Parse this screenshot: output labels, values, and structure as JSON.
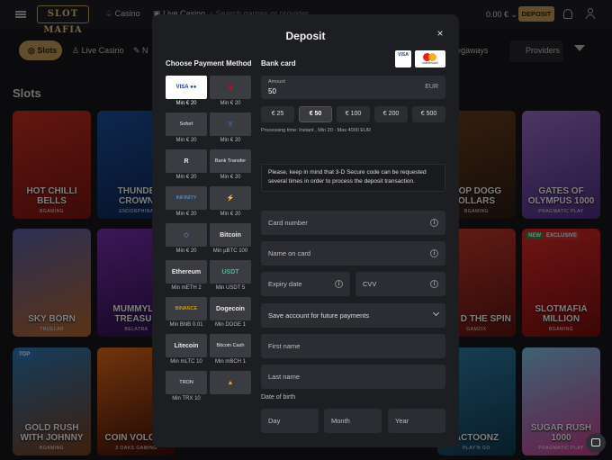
{
  "header": {
    "logo_text": "SLOT MAFIA",
    "casino_label": "Casino",
    "live_casino_label": "Live Casino",
    "search_placeholder": "Search games or provider",
    "balance": "0.00 €",
    "deposit_label": "DEPOSIT"
  },
  "categories": {
    "slots": "Slots",
    "live": "Live Casino",
    "new": "N",
    "megaways": "egaways",
    "providers": "Providers"
  },
  "section_title": "Slots",
  "games": [
    {
      "title": "HOT CHILLI BELLS",
      "provider": "BGAMING"
    },
    {
      "title": "THUNDE CROWN",
      "provider": "ENDORPHINA"
    },
    {
      "title": "OOP DOGG OLLARS",
      "provider": "BGAMING"
    },
    {
      "title": "GATES OF OLYMPUS 1000",
      "provider": "PRAGMATIC PLAY"
    },
    {
      "title": "SKY BORN",
      "provider": "TRUELAB"
    },
    {
      "title": "MUMMYLA TREASUR",
      "provider": "BELATRA"
    },
    {
      "title": "3X3 D THE SPIN",
      "provider": "GAMZIX"
    },
    {
      "title": "SLOTMAFIA MILLION",
      "provider": "BGAMING",
      "badges": [
        "NEW",
        "EXCLUSIVE"
      ]
    },
    {
      "title": "GOLD RUSH WITH JOHNNY",
      "provider": "BGAMING",
      "badges": [
        "TOP"
      ]
    },
    {
      "title": "COIN VOLCAN",
      "provider": "3 OAKS GAMING"
    },
    {
      "title": "ACTOONZ",
      "provider": "PLAY'N GO"
    },
    {
      "title": "SUGAR RUSH 1000",
      "provider": "PRAGMATIC PLAY"
    }
  ],
  "modal": {
    "title": "Deposit",
    "close": "×",
    "choose_method_label": "Choose Payment Method",
    "bank_card_label": "Bank card",
    "card_logos": [
      "VISA",
      "mastercard"
    ],
    "methods": [
      {
        "label": "VISA ●●",
        "caption": "Min € 20"
      },
      {
        "label": "S",
        "caption": "Min € 20"
      },
      {
        "label": "Sofort",
        "caption": "Min € 20"
      },
      {
        "label": "V",
        "caption": "Min € 20"
      },
      {
        "label": "R",
        "caption": "Min € 20"
      },
      {
        "label": "Bank Transfer",
        "caption": "Min € 20"
      },
      {
        "label": "INFINITY",
        "caption": "Min € 20"
      },
      {
        "label": "⚡",
        "caption": "Min € 20"
      },
      {
        "label": "◇",
        "caption": "Min € 20"
      },
      {
        "label": "Bitcoin",
        "caption": "Min µBTC 100"
      },
      {
        "label": "Ethereum",
        "caption": "Min mETH 2"
      },
      {
        "label": "USDT",
        "caption": "Min USDT 5"
      },
      {
        "label": "BINANCE",
        "caption": "Min BNB 0.01"
      },
      {
        "label": "Dogecoin",
        "caption": "Min DOGE 1"
      },
      {
        "label": "Litecoin",
        "caption": "Min mLTC 10"
      },
      {
        "label": "Bitcoin Cash",
        "caption": "Min mBCH 1"
      },
      {
        "label": "TRON",
        "caption": "Min TRX 10"
      },
      {
        "label": "▲",
        "caption": ""
      }
    ],
    "amount_caption": "Amount",
    "amount_value": "50",
    "currency": "EUR",
    "quick_amounts": [
      "€ 25",
      "€ 50",
      "€ 100",
      "€ 200",
      "€ 500"
    ],
    "selected_amount": "€ 50",
    "processing_text": "Processing time: Instant , Min 20 - Max 4000 EUR",
    "secure_note": "Please, keep in mind that 3-D Secure code can be requested several times in order to process the deposit transaction.",
    "card_number_placeholder": "Card number",
    "name_on_card_placeholder": "Name on card",
    "expiry_placeholder": "Expiry date",
    "cvv_placeholder": "CVV",
    "save_account_label": "Save account for future payments",
    "first_name_placeholder": "First name",
    "last_name_placeholder": "Last name",
    "dob_label": "Date of birth",
    "day_placeholder": "Day",
    "month_placeholder": "Month",
    "year_placeholder": "Year",
    "info_glyph": "i"
  }
}
